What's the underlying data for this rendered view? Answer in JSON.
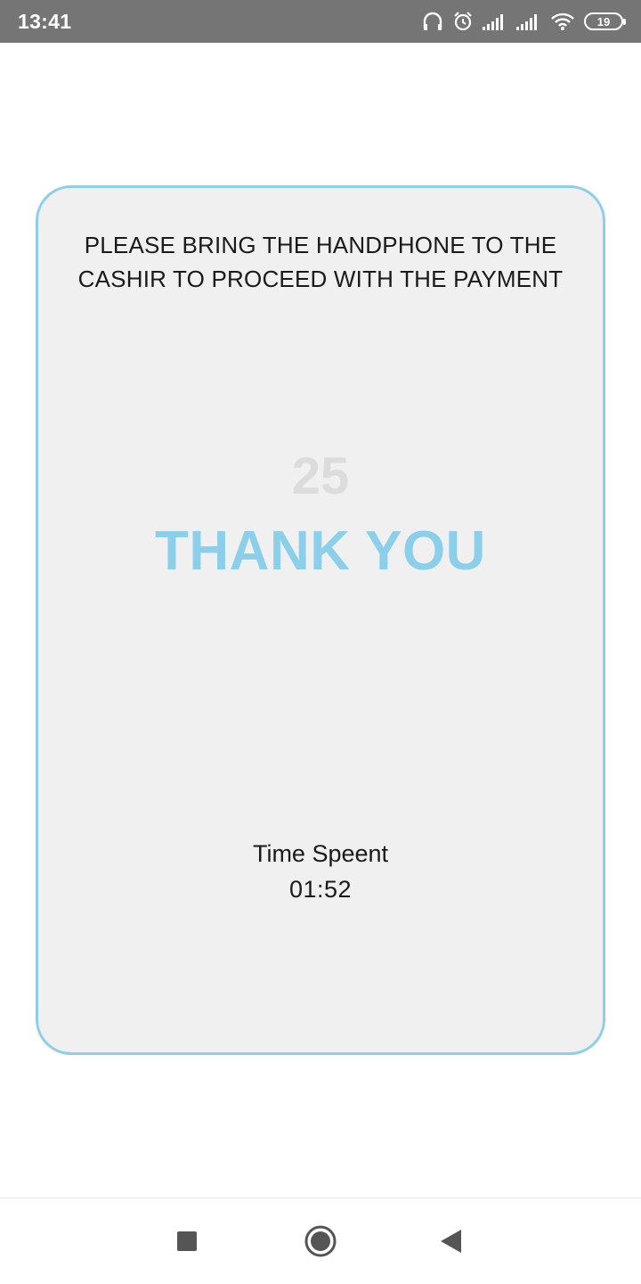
{
  "status_bar": {
    "time": "13:41",
    "battery": "19",
    "icons": [
      "headphones-icon",
      "alarm-icon",
      "signal-icon",
      "signal-icon",
      "wifi-icon",
      "battery-icon"
    ]
  },
  "card": {
    "instruction_line1": "PLEASE BRING THE HANDPHONE TO THE",
    "instruction_line2": "CASHIR TO PROCEED WITH THE PAYMENT",
    "countdown": "25",
    "thank_you": "THANK YOU",
    "time_spent_label": "Time Speent",
    "time_spent_value": "01:52"
  },
  "nav_bar": {
    "buttons": [
      "recents-icon",
      "home-icon",
      "back-icon"
    ]
  },
  "colors": {
    "accent": "#8ccfea",
    "card_bg": "#f0f0f0",
    "status_bar_bg": "#757575",
    "countdown": "#dcdcdc"
  }
}
